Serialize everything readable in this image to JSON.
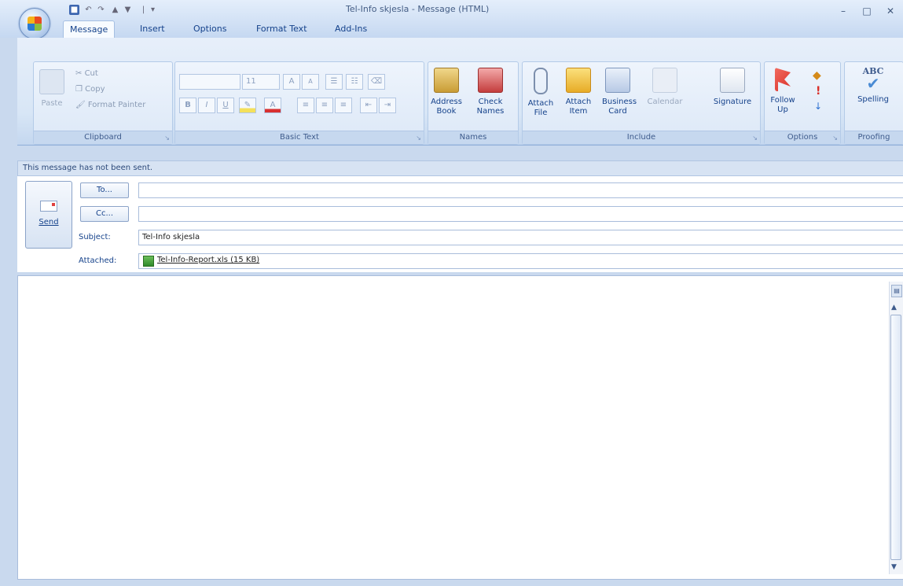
{
  "window": {
    "title": "Tel-Info skjesla - Message (HTML)",
    "minimize_glyph": "–",
    "maximize_glyph": "□",
    "close_glyph": "✕"
  },
  "quick_access": {
    "dropdown_glyph": "▾"
  },
  "tabs": [
    {
      "label": "Message",
      "active": true
    },
    {
      "label": "Insert",
      "active": false
    },
    {
      "label": "Options",
      "active": false
    },
    {
      "label": "Format Text",
      "active": false
    },
    {
      "label": "Add-Ins",
      "active": false
    }
  ],
  "ribbon": {
    "clipboard": {
      "label": "Clipboard",
      "paste": "Paste",
      "cut": "Cut",
      "copy": "Copy",
      "format_painter": "Format Painter"
    },
    "basic_text": {
      "label": "Basic Text",
      "font_size": "11",
      "grow": "A",
      "shrink": "A",
      "bold": "B",
      "italic": "I",
      "underline": "U"
    },
    "names": {
      "label": "Names",
      "address_book": "Address Book",
      "check_names": "Check Names"
    },
    "include": {
      "label": "Include",
      "attach_file": "Attach File",
      "attach_item": "Attach Item",
      "business_card": "Business Card",
      "calendar": "Calendar",
      "signature": "Signature"
    },
    "options": {
      "label": "Options",
      "follow_up": "Follow Up"
    },
    "proofing": {
      "label": "Proofing",
      "spelling": "Spelling",
      "abc": "ABC"
    }
  },
  "infobar": {
    "text": "This message has not been sent."
  },
  "compose": {
    "send_label": "Send",
    "to_label": "To...",
    "cc_label": "Cc...",
    "to_value": "",
    "cc_value": "",
    "subject_label": "Subject:",
    "subject_value": "Tel-Info skjesla",
    "attached_label": "Attached:",
    "attachment_name": "Tel-Info-Report.xls (15 KB)"
  },
  "body": {
    "text": ""
  },
  "colors": {
    "accent": "#15428b",
    "ribbon": "#d8e6f6",
    "follow_up_flag": "#d9302a"
  }
}
